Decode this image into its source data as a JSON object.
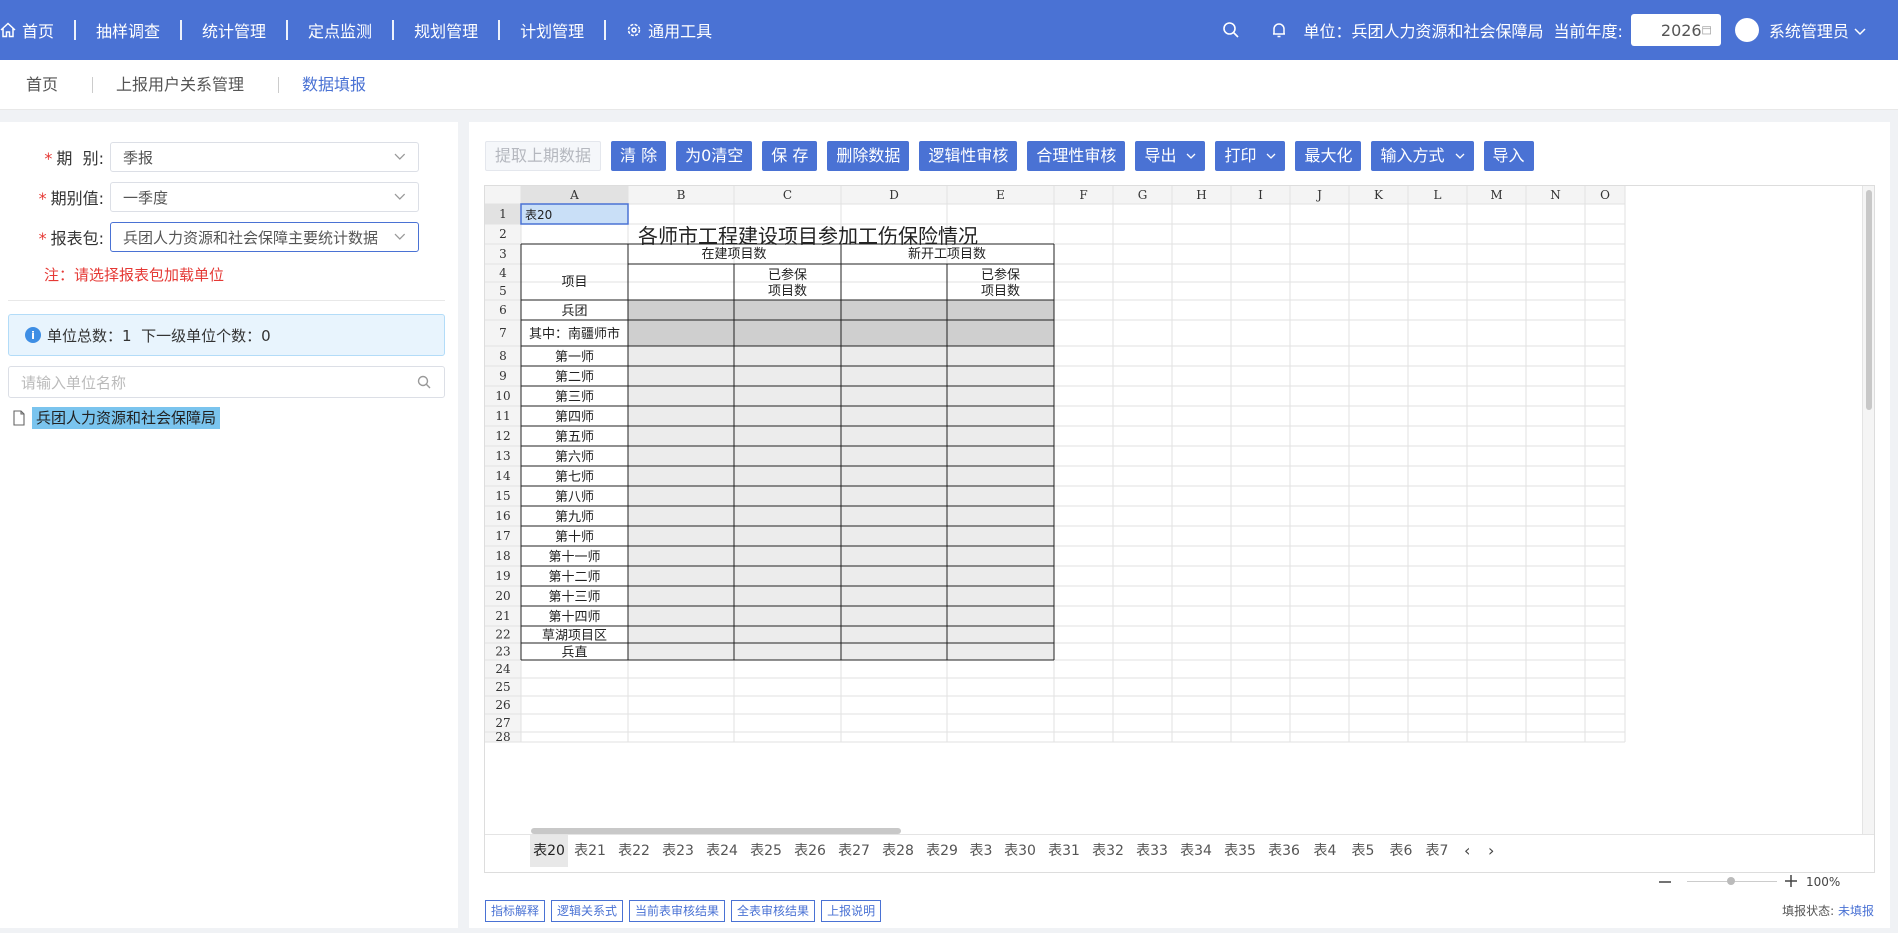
{
  "nav": {
    "items": [
      {
        "label": "首页",
        "icon": "home-icon"
      },
      {
        "label": "抽样调查"
      },
      {
        "label": "统计管理"
      },
      {
        "label": "定点监测"
      },
      {
        "label": "规划管理"
      },
      {
        "label": "计划管理"
      },
      {
        "label": "通用工具",
        "icon": "gear-icon"
      }
    ],
    "unit_label": "单位：兵团人力资源和社会保障局",
    "year_label": "当前年度:",
    "year_value": "2026",
    "user_name": "系统管理员"
  },
  "subnav": {
    "items": [
      "首页",
      "上报用户关系管理",
      "数据填报"
    ],
    "active": 2
  },
  "left": {
    "period": {
      "label": "期  别:",
      "value": "季报"
    },
    "period_value": {
      "label": "期别值:",
      "value": "一季度"
    },
    "package": {
      "label": "报表包:",
      "value": "兵团人力资源和社会保障主要统计数据"
    },
    "note": "注：请选择报表包加载单位",
    "info": "单位总数：1  下一级单位个数：0",
    "search_placeholder": "请输入单位名称",
    "tree_item": "兵团人力资源和社会保障局"
  },
  "toolbar": [
    {
      "label": "提取上期数据",
      "disabled": true
    },
    {
      "label": "清 除"
    },
    {
      "label": "为0清空"
    },
    {
      "label": "保 存"
    },
    {
      "label": "删除数据"
    },
    {
      "label": "逻辑性审核"
    },
    {
      "label": "合理性审核"
    },
    {
      "label": "导出",
      "dropdown": true
    },
    {
      "label": "打印",
      "dropdown": true
    },
    {
      "label": "最大化"
    },
    {
      "label": "输入方式",
      "dropdown": true
    },
    {
      "label": "导入"
    }
  ],
  "sheet": {
    "columns": [
      "A",
      "B",
      "C",
      "D",
      "E",
      "F",
      "G",
      "H",
      "I",
      "J",
      "K",
      "L",
      "M",
      "N",
      "O"
    ],
    "row_numbers": [
      "1",
      "2",
      "3",
      "4",
      "5",
      "6",
      "7",
      "8",
      "9",
      "10",
      "11",
      "12",
      "13",
      "14",
      "15",
      "16",
      "17",
      "18",
      "19",
      "20",
      "21",
      "22",
      "23",
      "24",
      "25",
      "26",
      "27",
      "28"
    ],
    "a1": "表20",
    "title": "各师市工程建设项目参加工伤保险情况",
    "header_project": "项目",
    "header_inbuild": "在建项目数",
    "header_newstart": "新开工项目数",
    "header_insured_c": "已参保\n项目数",
    "header_insured_e": "已参保\n项目数",
    "row_labels": [
      "兵团",
      "其中：南疆师市",
      "第一师",
      "第二师",
      "第三师",
      "第四师",
      "第五师",
      "第六师",
      "第七师",
      "第八师",
      "第九师",
      "第十师",
      "第十一师",
      "第十二师",
      "第十三师",
      "第十四师",
      "草湖项目区",
      "兵直"
    ]
  },
  "tabs": [
    "表20",
    "表21",
    "表22",
    "表23",
    "表24",
    "表25",
    "表26",
    "表27",
    "表28",
    "表29",
    "表3",
    "表30",
    "表31",
    "表32",
    "表33",
    "表34",
    "表35",
    "表36",
    "表4",
    "表5",
    "表6",
    "表7"
  ],
  "zoom": "100%",
  "footer": [
    "指标解释",
    "逻辑关系式",
    "当前表审核结果",
    "全表审核结果",
    "上报说明"
  ],
  "status": {
    "label": "填报状态:",
    "value": "未填报"
  },
  "colors": {
    "primary": "#4a72d4",
    "danger": "#e53935",
    "shaded_dark": "#cfcfcf",
    "shaded_light": "#ececec"
  }
}
